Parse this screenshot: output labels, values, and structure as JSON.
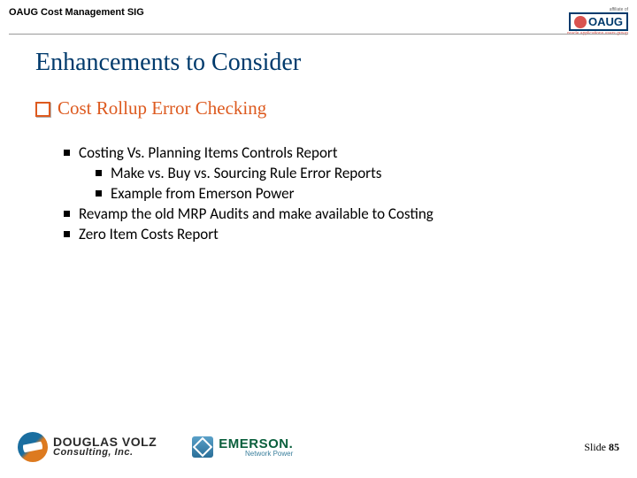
{
  "header": {
    "title": "OAUG Cost Management SIG",
    "affiliate": "affiliate of",
    "logo_text": "OAUG",
    "logo_tag": "oracle applications users group"
  },
  "slide": {
    "title": "Enhancements to Consider",
    "section": "Cost Rollup Error Checking",
    "bullets": [
      {
        "level": 1,
        "text": "Costing Vs. Planning Items Controls Report"
      },
      {
        "level": 2,
        "text": "Make vs. Buy vs. Sourcing Rule Error Reports"
      },
      {
        "level": 2,
        "text": "Example from Emerson Power"
      },
      {
        "level": 1,
        "text": "Revamp the old MRP Audits and make available to Costing"
      },
      {
        "level": 1,
        "text": "Zero Item Costs Report"
      }
    ]
  },
  "footer": {
    "dv_line1": "DOUGLAS VOLZ",
    "dv_line2": "Consulting, Inc.",
    "em_line1": "EMERSON.",
    "em_line2": "Network Power",
    "slide_label": "Slide ",
    "slide_number": "85"
  }
}
